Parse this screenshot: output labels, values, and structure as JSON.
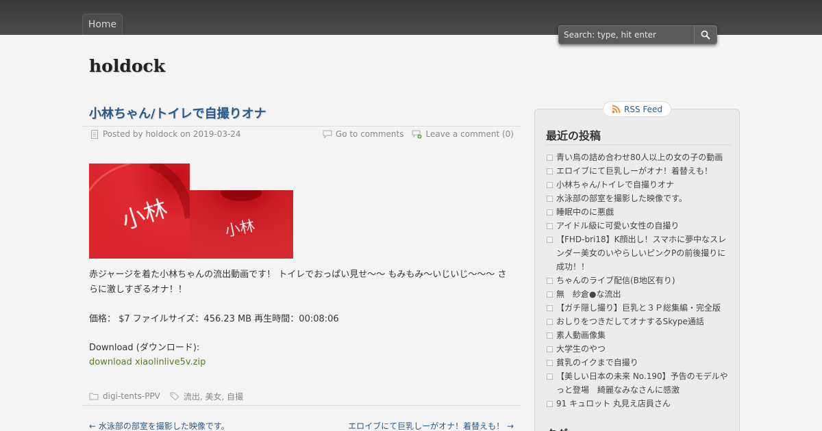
{
  "nav": {
    "home_label": "Home"
  },
  "search": {
    "placeholder": "Search: type, hit enter"
  },
  "site": {
    "title": "holdock"
  },
  "post": {
    "title": "小林ちゃん/トイレで自撮りオナ",
    "meta_posted": "Posted by holdock on 2019-03-24",
    "goto_comments": "Go to comments",
    "leave_comment": "Leave a comment (0)",
    "paragraph1": "赤ジャージを着た小林ちゃんの流出動画です！ トイレでおっぱい見せ～～ もみもみ～いじいじ～～～ さらに激しすぎるオナ！！",
    "price_line": "価格： $7 ファイルサイズ：456.23 MB 再生時間：00:08:06",
    "download_label": "Download (ダウンロード):",
    "download_link": "download xiaolinlive5v.zip",
    "category": "digi-tents-PPV",
    "tags": "流出, 美女, 自撮",
    "prev_link": "← 水泳部の部室を撮影した映像です。",
    "next_link": "エロイブにて巨乳しーがオナ！着替えも！ →",
    "image_text_1": "小林",
    "image_text_2": "小林"
  },
  "sidebar": {
    "rss_label": "RSS Feed",
    "recent_title": "最近の投稿",
    "recent_items": [
      "青い鳥の詰め合わせ80人以上の女の子の動画",
      "エロイブにて巨乳しーがオナ！着替えも！",
      "小林ちゃん/トイレで自撮りオナ",
      "水泳部の部室を撮影した映像です。",
      "睡眠中のに悪戯",
      "アイドル級に可愛い女性の自撮り",
      "【FHD-bri18】K顔出し！スマホに夢中なスレンダー美女のいやらしいピンクPの前後撮りに成功！！",
      "ちゃんのライブ配信(B地区有り)",
      "無　紗倉●な流出",
      "【ガチ隠し撮り】巨乳と３Ｐ総集編・完全版",
      "おしりをつきだしてオナするSkype通話",
      "素人動画像集",
      "大学生のやつ",
      "貧乳のイクまで自撮り",
      "【美しい日本の未来 No.190】予告のモデルやっと登場　綺麗なみなさんに感激",
      "91 キュロット 丸見え店員さん"
    ],
    "tags_title": "タグ"
  },
  "colors": {
    "link": "#2a5a8a",
    "download": "#5a7a2a",
    "topbar": "#3e3e3e",
    "image_red": "#d8262c"
  }
}
